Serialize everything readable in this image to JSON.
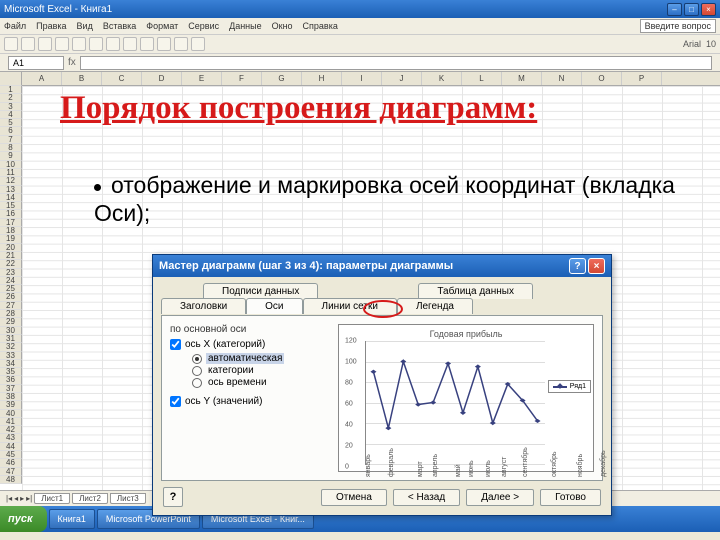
{
  "window": {
    "title": "Microsoft Excel - Книга1",
    "question_box": "Введите вопрос"
  },
  "menu": [
    "Файл",
    "Правка",
    "Вид",
    "Вставка",
    "Формат",
    "Сервис",
    "Данные",
    "Окно",
    "Справка"
  ],
  "cellref": "A1",
  "cols": [
    "A",
    "B",
    "C",
    "D",
    "E",
    "F",
    "G",
    "H",
    "I",
    "J",
    "K",
    "L",
    "M",
    "N",
    "O",
    "P"
  ],
  "presentation": {
    "title": "Порядок построения диаграмм:",
    "bullet": "отображение и маркировка осей координат (вкладка Оси);"
  },
  "dialog": {
    "title": "Мастер диаграмм (шаг 3 из 4): параметры диаграммы",
    "tabs_row1": [
      "Подписи данных",
      "Таблица данных"
    ],
    "tabs_row2": [
      "Заголовки",
      "Оси",
      "Линии сетки",
      "Легенда"
    ],
    "active_tab": "Оси",
    "group": "по основной оси",
    "cb_x": "ось X (категорий)",
    "radios": [
      "автоматическая",
      "категории",
      "ось времени"
    ],
    "radio_selected": "автоматическая",
    "cb_y": "ось Y (значений)",
    "preview_title": "Годовая прибыль",
    "legend": "Ряд1",
    "buttons": {
      "cancel": "Отмена",
      "back": "< Назад",
      "next": "Далее >",
      "finish": "Готово"
    }
  },
  "sheets": [
    "Лист1",
    "Лист2",
    "Лист3"
  ],
  "taskbar": {
    "start": "пуск",
    "items": [
      "Книга1",
      "Microsoft PowerPoint",
      "Microsoft Excel - Книг..."
    ]
  },
  "chart_data": {
    "type": "line",
    "title": "Годовая прибыль",
    "categories": [
      "январь",
      "февраль",
      "март",
      "апрель",
      "май",
      "июнь",
      "июль",
      "август",
      "сентябрь",
      "октябрь",
      "ноябрь",
      "декабрь"
    ],
    "values": [
      90,
      35,
      100,
      58,
      60,
      98,
      50,
      95,
      40,
      78,
      62,
      42
    ],
    "series": [
      {
        "name": "Ряд1"
      }
    ],
    "ylim": [
      0,
      120
    ],
    "yticks": [
      0,
      20,
      40,
      60,
      80,
      100,
      120
    ]
  }
}
